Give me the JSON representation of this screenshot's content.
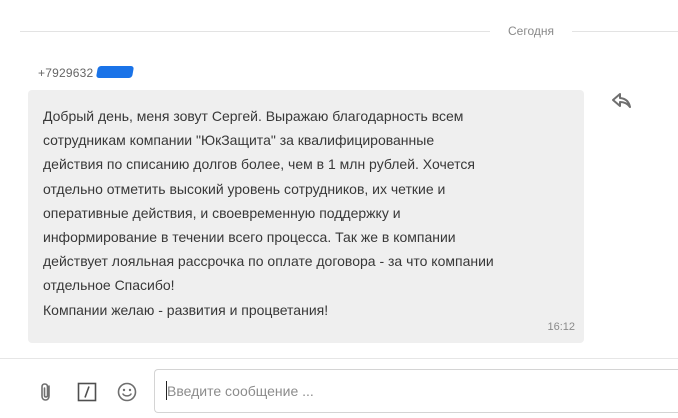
{
  "chat": {
    "date_divider": "Сегодня",
    "sender": "+7929632"
  },
  "message": {
    "lines": [
      "Добрый день, меня зовут Сергей. Выражаю благодарность всем",
      "сотрудникам компании \"ЮкЗащита\" за квалифицированные",
      "действия по списанию долгов более, чем в 1 млн рублей. Хочется",
      "отдельно отметить высокий уровень сотрудников, их четкие и",
      "оперативные действия, и своевременную поддержку и",
      "информирование в течении всего процесса. Так же в компании",
      "действует лояльная рассрочка по оплате договора - за что компании",
      "отдельное Спасибо!",
      "Компании желаю - развития и процветания!"
    ],
    "time": "16:12",
    "reply_icon": "reply-icon"
  },
  "composer": {
    "placeholder": "Введите сообщение ...",
    "value": "",
    "tools": [
      "paperclip-icon",
      "template-icon",
      "emoji-icon"
    ]
  },
  "colors": {
    "bubble": "#efefef",
    "redaction": "#1a73e8",
    "muted_text": "#8a8a8a"
  }
}
